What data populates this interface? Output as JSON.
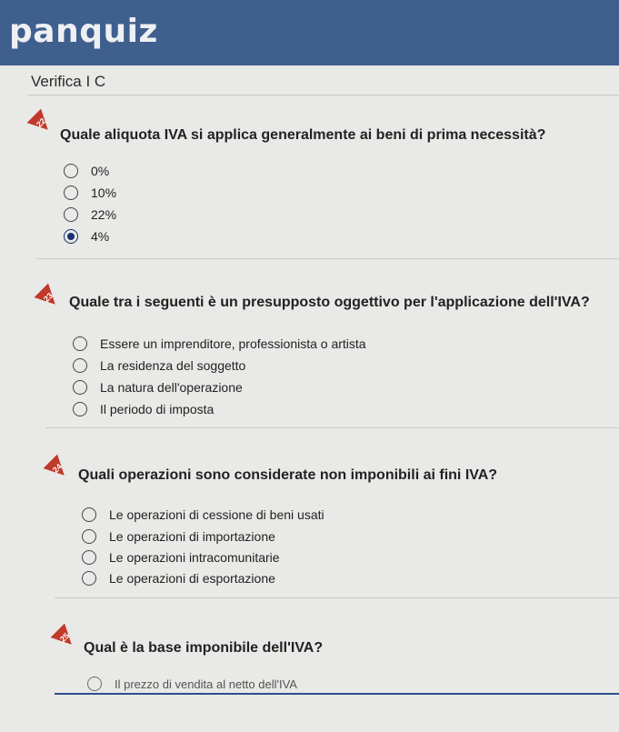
{
  "app": {
    "brand": "panquiz"
  },
  "quiz": {
    "title": "Verifica I C"
  },
  "questions": [
    {
      "number": "22",
      "text": "Quale aliquota IVA si applica generalmente ai beni di prima necessità?",
      "options": [
        "0%",
        "10%",
        "22%",
        "4%"
      ],
      "selected_index": 3
    },
    {
      "number": "23",
      "text": "Quale tra i seguenti è un presupposto oggettivo per l'applicazione dell'IVA?",
      "options": [
        "Essere un imprenditore, professionista o artista",
        "La residenza del soggetto",
        "La natura dell'operazione",
        "Il periodo di imposta"
      ],
      "selected_index": null
    },
    {
      "number": "24",
      "text": "Quali operazioni sono considerate non imponibili ai fini IVA?",
      "options": [
        "Le operazioni di cessione di beni usati",
        "Le operazioni di importazione",
        "Le operazioni intracomunitarie",
        "Le operazioni di esportazione"
      ],
      "selected_index": null
    },
    {
      "number": "25",
      "text": "Qual è la base imponibile dell'IVA?",
      "options": [
        "Il prezzo di vendita al netto dell'IVA"
      ],
      "selected_index": null
    }
  ],
  "colors": {
    "header": "#3f5f8f",
    "badge": "#c0392b",
    "radio_selected": "#1a2f6e"
  }
}
